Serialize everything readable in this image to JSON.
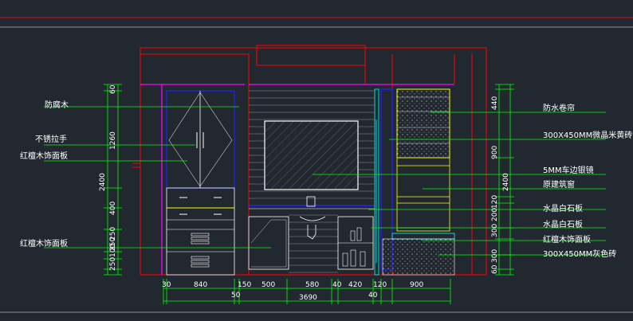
{
  "labels_left": [
    {
      "id": "anti-corrosion-wood",
      "text": "防腐木"
    },
    {
      "id": "stainless-handle",
      "text": "不锈拉手"
    },
    {
      "id": "sandalwood-panel-upper",
      "text": "红檀木饰面板"
    },
    {
      "id": "sandalwood-panel-lower",
      "text": "红檀木饰面板"
    }
  ],
  "labels_right": [
    {
      "id": "waterproof-blind",
      "text": "防水卷帘"
    },
    {
      "id": "crystal-brick",
      "text": "300X450MM微晶米黄砖"
    },
    {
      "id": "beveled-mirror",
      "text": "5MM车边银镜"
    },
    {
      "id": "original-window",
      "text": "原建筑窗"
    },
    {
      "id": "marble-board-1",
      "text": "水晶白石板"
    },
    {
      "id": "marble-board-2",
      "text": "水晶白石板"
    },
    {
      "id": "sandalwood-panel-right",
      "text": "红檀木饰面板"
    },
    {
      "id": "grey-brick",
      "text": "300X450MM灰色砖"
    }
  ],
  "dims_bottom": [
    "30",
    "840",
    "150",
    "500",
    "580",
    "40",
    "420",
    "120",
    "900"
  ],
  "dims_bottom_row2": [
    "50",
    "40"
  ],
  "dims_total": "3690",
  "dims_left": [
    "60",
    "1260",
    "400",
    "250",
    "250",
    "100",
    "250"
  ],
  "dims_left_total": "2400",
  "dims_right": [
    "440",
    "900",
    "120",
    "200",
    "300",
    "300",
    "60"
  ],
  "dims_right_total": "2400",
  "colors": {
    "background": "#212830",
    "leader": "#00ff00",
    "frame": "#ff0000",
    "magenta": "#ff00ff",
    "blue": "#2222ff",
    "yellow": "#ffff00",
    "cyan": "#00ffff",
    "white": "#ffffff"
  }
}
